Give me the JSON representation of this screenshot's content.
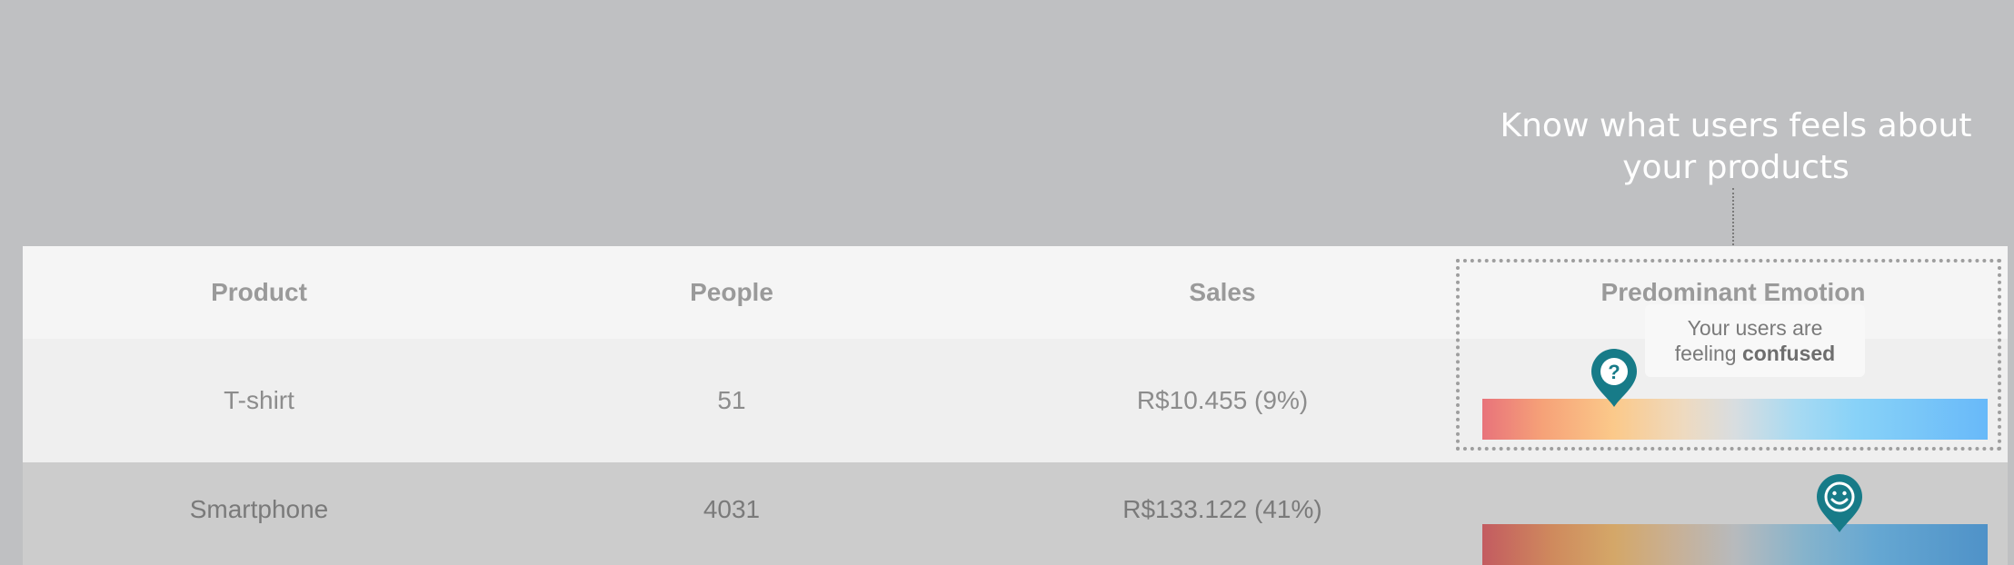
{
  "callout": {
    "line1": "Know what users feels about",
    "line2": "your products"
  },
  "table": {
    "headers": [
      "Product",
      "People",
      "Sales",
      "Predominant Emotion"
    ],
    "rows": [
      {
        "product": "T-shirt",
        "people": "51",
        "sales": "R$10.455 (9%)",
        "emotion_icon": "question-icon",
        "emotion_level": 0.26
      },
      {
        "product": "Smartphone",
        "people": "4031",
        "sales": "R$133.122 (41%)",
        "emotion_icon": "smiley-icon",
        "emotion_level": 0.71
      }
    ]
  },
  "tooltip": {
    "line1": "Your users are",
    "prefix": "feeling",
    "emotion": "confused"
  },
  "colors": {
    "pin": "#177b88",
    "background": "#bfc0c2"
  }
}
